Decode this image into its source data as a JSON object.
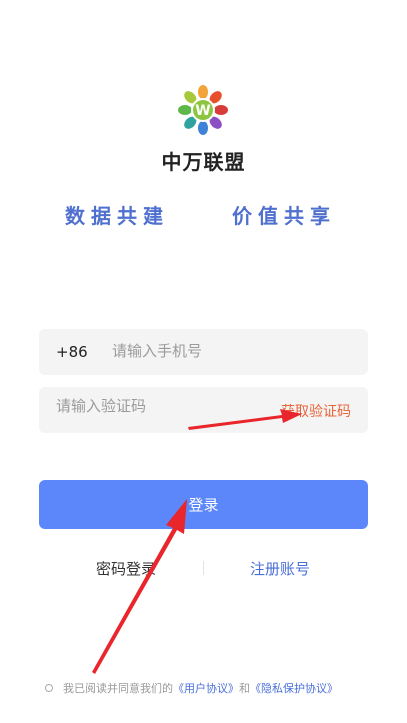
{
  "app": {
    "name": "中万联盟",
    "slogan_left": "数据共建",
    "slogan_right": "价值共享",
    "logo_letter": "W"
  },
  "login_form": {
    "country_code": "+86",
    "phone_placeholder": "请输入手机号",
    "code_placeholder": "请输入验证码",
    "get_code_label": "获取验证码",
    "login_label": "登录",
    "password_login_label": "密码登录",
    "register_label": "注册账号"
  },
  "agreement": {
    "prefix": "我已阅读并同意我们的",
    "user_agreement": "《用户协议》",
    "connector": "和",
    "privacy_policy": "《隐私保护协议》"
  },
  "colors": {
    "brand_blue": "#4f70cf",
    "button_blue": "#5b87fa",
    "accent_orange": "#e8643a",
    "annotation_red": "#e8262b"
  }
}
